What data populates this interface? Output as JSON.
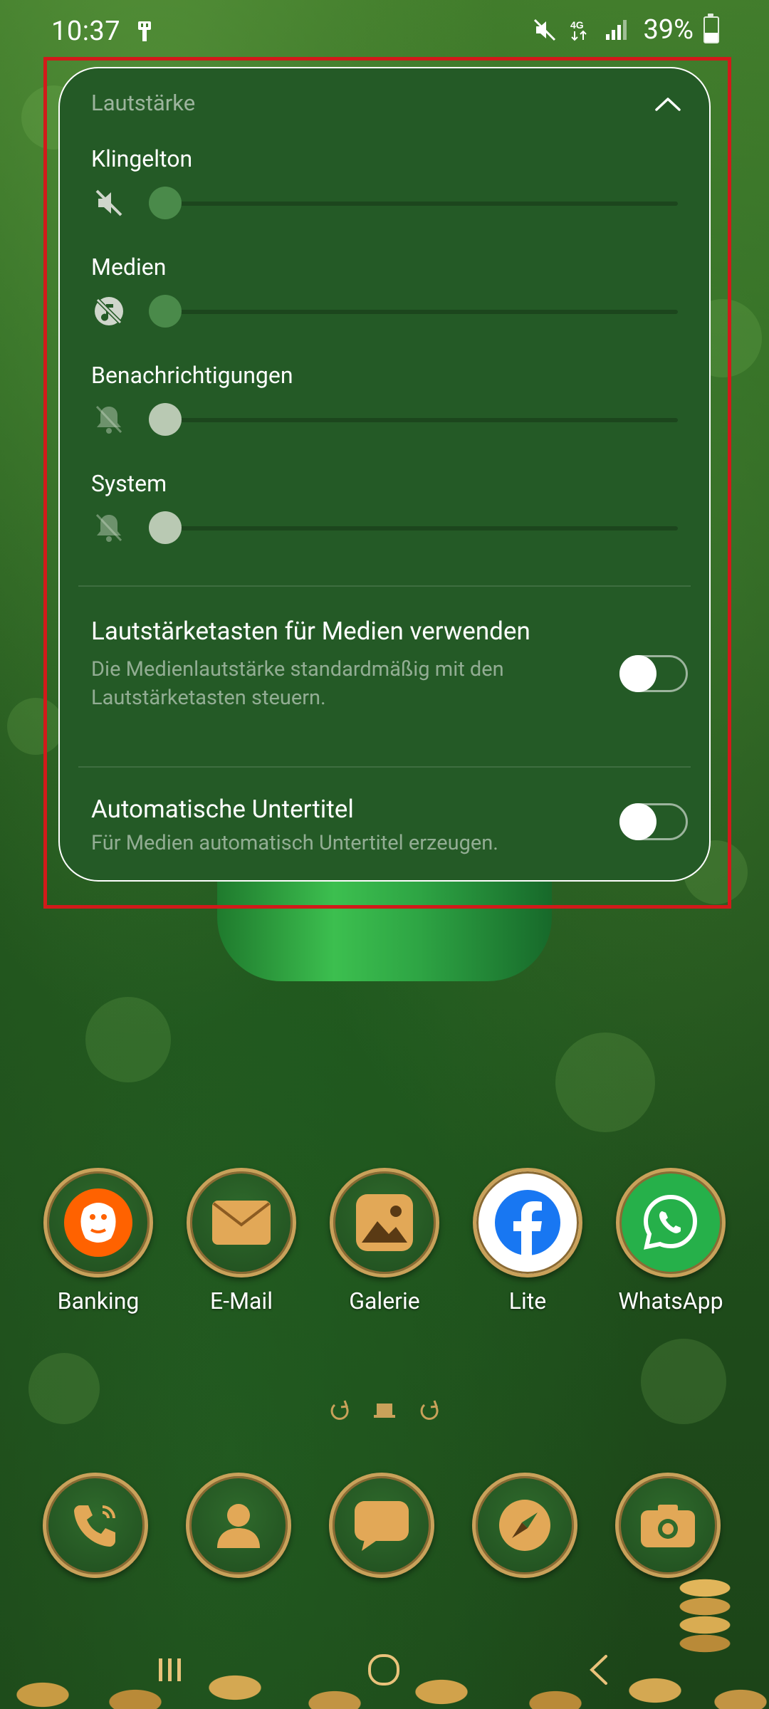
{
  "status_bar": {
    "time": "10:37",
    "battery": "39%",
    "battery_level": 0.39,
    "network": "4G",
    "icons": [
      "usb-icon",
      "mute-icon",
      "4g-icon",
      "signal-icon",
      "battery-icon"
    ]
  },
  "volume_panel": {
    "title": "Lautstärke",
    "rows": [
      {
        "label": "Klingelton",
        "icon": "ringtone-muted-icon",
        "level": 0
      },
      {
        "label": "Medien",
        "icon": "media-muted-icon",
        "level": 0
      },
      {
        "label": "Benachrichtigungen",
        "icon": "notification-muted-icon",
        "level": 0
      },
      {
        "label": "System",
        "icon": "system-muted-icon",
        "level": 0
      }
    ],
    "settings": [
      {
        "title": "Lautstärketasten für Medien verwenden",
        "description": "Die Medienlautstärke standardmäßig mit den Lautstärketasten steuern.",
        "enabled": false
      },
      {
        "title": "Automatische Untertitel",
        "description": "Für Medien automatisch Untertitel erzeugen.",
        "enabled": false
      }
    ]
  },
  "apps": [
    {
      "label": "Banking",
      "icon": "ing-lion-icon"
    },
    {
      "label": "E-Mail",
      "icon": "envelope-icon"
    },
    {
      "label": "Galerie",
      "icon": "gallery-icon"
    },
    {
      "label": "Lite",
      "icon": "facebook-icon"
    },
    {
      "label": "WhatsApp",
      "icon": "whatsapp-icon"
    }
  ],
  "dock": [
    {
      "icon": "phone-icon"
    },
    {
      "icon": "contacts-icon"
    },
    {
      "icon": "messages-icon"
    },
    {
      "icon": "browser-compass-icon"
    },
    {
      "icon": "camera-icon"
    }
  ],
  "colors": {
    "panel_bg": "#245a26",
    "highlight": "#d21a1a",
    "gold": "#c9a15a"
  }
}
